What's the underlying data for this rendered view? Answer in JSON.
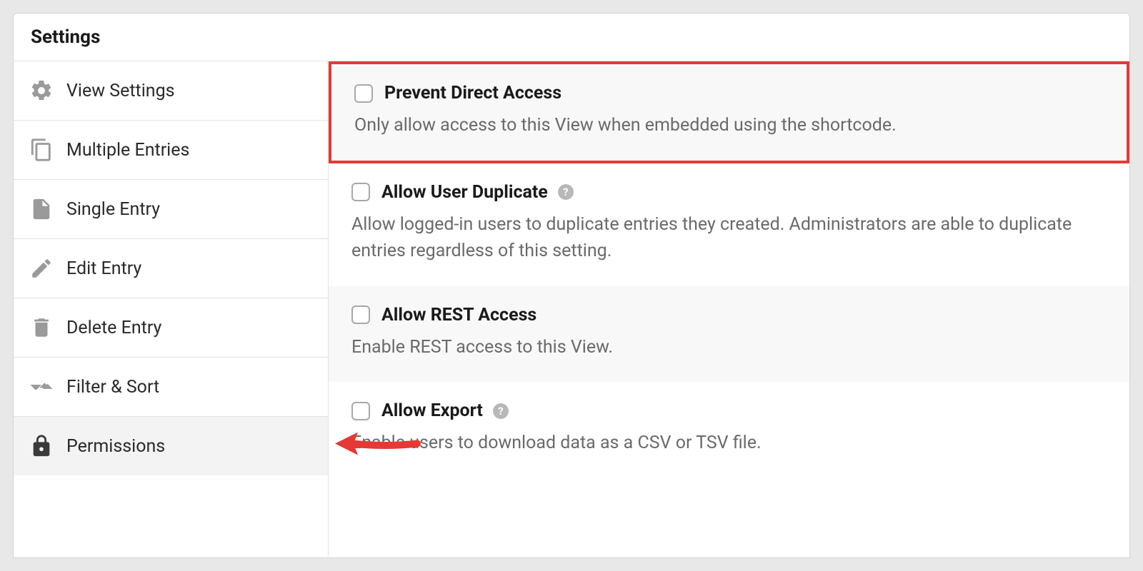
{
  "header": {
    "title": "Settings"
  },
  "sidebar": {
    "items": [
      {
        "label": "View Settings",
        "icon": "gear"
      },
      {
        "label": "Multiple Entries",
        "icon": "copy"
      },
      {
        "label": "Single Entry",
        "icon": "file"
      },
      {
        "label": "Edit Entry",
        "icon": "pencil-square"
      },
      {
        "label": "Delete Entry",
        "icon": "trash"
      },
      {
        "label": "Filter & Sort",
        "icon": "sort"
      },
      {
        "label": "Permissions",
        "icon": "lock",
        "active": true
      }
    ]
  },
  "settings": [
    {
      "title": "Prevent Direct Access",
      "description": "Only allow access to this View when embedded using the shortcode.",
      "help": false,
      "highlighted": true
    },
    {
      "title": "Allow User Duplicate",
      "description": "Allow logged-in users to duplicate entries they created. Administrators are able to duplicate entries regardless of this setting.",
      "help": true
    },
    {
      "title": "Allow REST Access",
      "description": "Enable REST access to this View.",
      "help": false,
      "alt": true
    },
    {
      "title": "Allow Export",
      "description": "Enable users to download data as a CSV or TSV file.",
      "help": true
    }
  ]
}
